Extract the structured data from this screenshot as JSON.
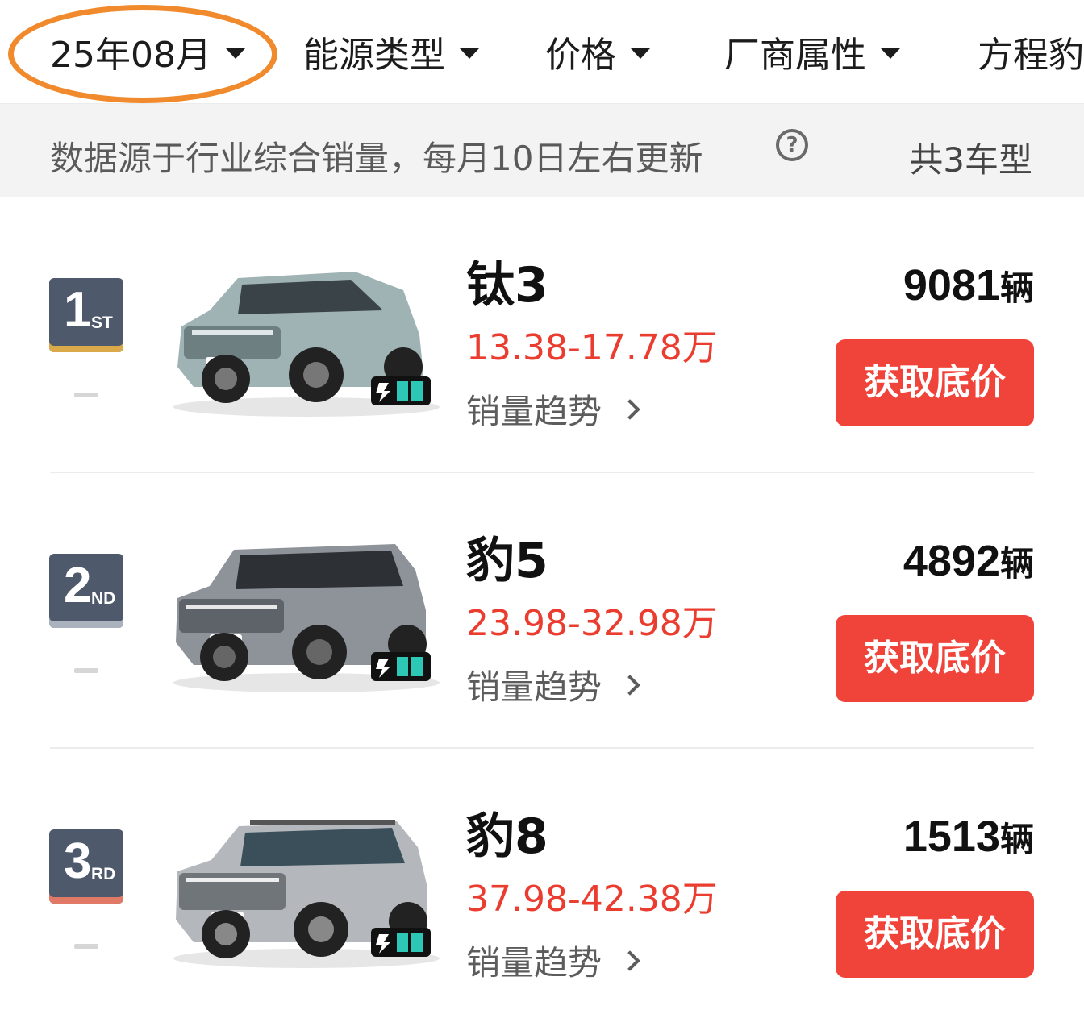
{
  "filters": [
    {
      "label": "25年08月"
    },
    {
      "label": "能源类型"
    },
    {
      "label": "价格"
    },
    {
      "label": "厂商属性"
    },
    {
      "label": "方程豹"
    }
  ],
  "info": {
    "source_text": "数据源于行业综合销量，每月10日左右更新",
    "help_symbol": "?",
    "count_text": "共3车型"
  },
  "colors": {
    "highlight": "#f08a2c",
    "price": "#ea3d2f",
    "button": "#f0433a",
    "badge": "#4e5a6b"
  },
  "ranking": [
    {
      "rank": "1",
      "suffix": "ST",
      "accent": "#d9a94a",
      "name": "钛3",
      "price": "13.38-17.78万",
      "trend_label": "销量趋势",
      "sales": "9081",
      "unit": "辆",
      "button_label": "获取底价",
      "car_color": "#9fb2b4"
    },
    {
      "rank": "2",
      "suffix": "ND",
      "accent": "#a9b2bd",
      "name": "豹5",
      "price": "23.98-32.98万",
      "trend_label": "销量趋势",
      "sales": "4892",
      "unit": "辆",
      "button_label": "获取底价",
      "car_color": "#8e9299"
    },
    {
      "rank": "3",
      "suffix": "RD",
      "accent": "#e07a66",
      "name": "豹8",
      "price": "37.98-42.38万",
      "trend_label": "销量趋势",
      "sales": "1513",
      "unit": "辆",
      "button_label": "获取底价",
      "car_color": "#b4b8bc"
    }
  ]
}
